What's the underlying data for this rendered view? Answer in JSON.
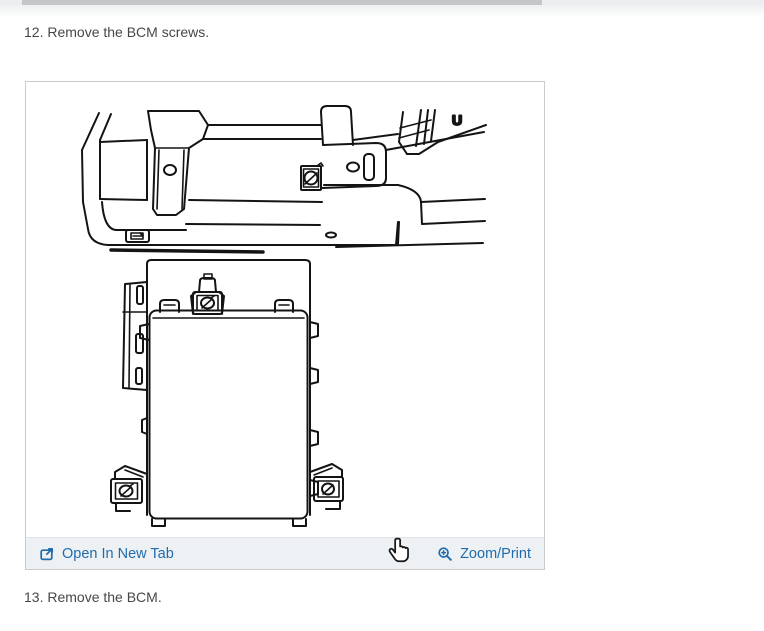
{
  "colors": {
    "link_blue": "#1f6bad",
    "footer_background": "#eef1f4",
    "frame_border": "#c9cccf",
    "body_text": "#454749",
    "line_art": "#141414",
    "scrollbar_thumb": "#c4c6c9",
    "scrollbar_track": "#eceef0"
  },
  "steps": [
    {
      "label": "12. Remove the BCM screws."
    },
    {
      "label": "13. Remove the BCM."
    }
  ],
  "figure": {
    "callout_label": "U",
    "footer": {
      "open_in_new_tab_label": "Open In New Tab",
      "zoom_print_label": "Zoom/Print"
    }
  },
  "icons": {
    "open_in_new_tab": "open-in-new-tab-icon",
    "zoom_print": "magnifier-plus-icon",
    "pointer": "hand-pointer-cursor"
  }
}
